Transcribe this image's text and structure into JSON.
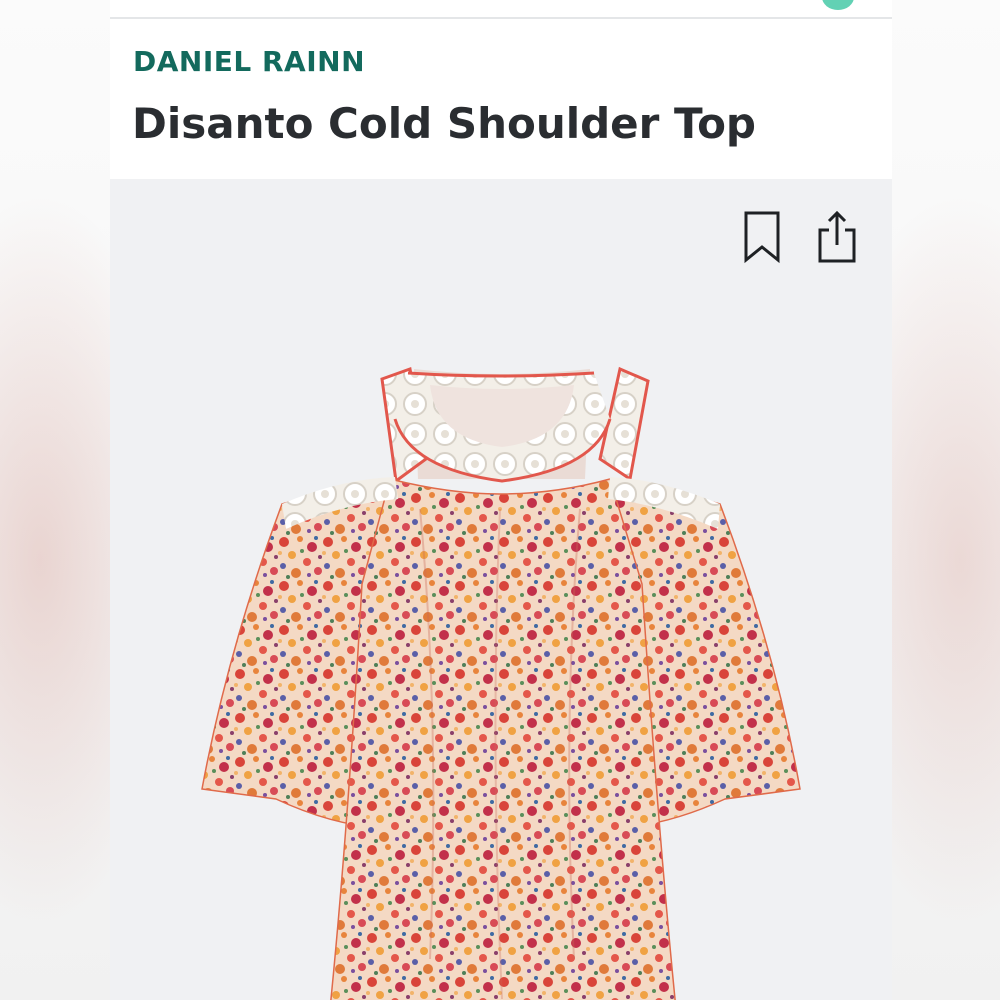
{
  "product": {
    "brand": "DANIEL RAINN",
    "title": "Disanto Cold Shoulder Top"
  },
  "actions": {
    "bookmark_icon": "bookmark-icon",
    "share_icon": "share-icon"
  },
  "colors": {
    "brand": "#136a5d",
    "title": "#2a2d31",
    "accent": "#62d1b4",
    "photo_background": "#f0f1f3"
  },
  "image": {
    "subject": "floral-print-cold-shoulder-top"
  }
}
